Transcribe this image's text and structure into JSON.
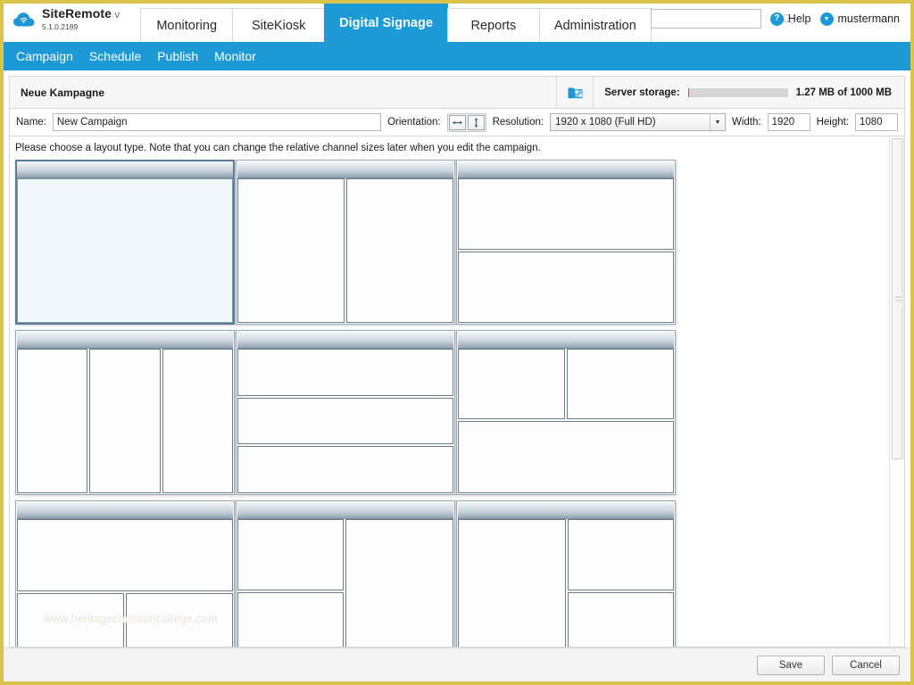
{
  "brand": {
    "name": "SiteRemote",
    "version": "V 5.1.0.2189",
    "logo_icon": "cloud-icon"
  },
  "nav": {
    "tabs": [
      {
        "label": "Monitoring",
        "active": false
      },
      {
        "label": "SiteKiosk",
        "active": false
      },
      {
        "label": "Digital Signage",
        "active": true
      },
      {
        "label": "Reports",
        "active": false
      },
      {
        "label": "Administration",
        "active": false
      }
    ]
  },
  "search": {
    "value": "",
    "placeholder": "",
    "icon": "search-icon"
  },
  "help": {
    "label": "Help",
    "icon": "question-mark-icon"
  },
  "user": {
    "label": "mustermann",
    "icon": "chevron-down-icon"
  },
  "subnav": {
    "items": [
      {
        "label": "Campaign"
      },
      {
        "label": "Schedule"
      },
      {
        "label": "Publish"
      },
      {
        "label": "Monitor"
      }
    ]
  },
  "panel": {
    "title": "Neue Kampagne",
    "storage_icon": "server-storage-icon",
    "storage_label": "Server storage:",
    "storage_value": "1.27 MB of 1000 MB",
    "storage_used_mb": 1.27,
    "storage_total_mb": 1000,
    "storage_percent": 0.127
  },
  "form": {
    "name_label": "Name:",
    "name_value": "New Campaign",
    "name_placeholder": "",
    "orientation_label": "Orientation:",
    "orientation_landscape_icon": "arrows-horizontal-icon",
    "orientation_portrait_icon": "arrows-vertical-icon",
    "resolution_label": "Resolution:",
    "resolution_value": "1920 x 1080 (Full HD)",
    "resolution_arrow_icon": "chevron-down-icon",
    "width_label": "Width:",
    "width_value": "1920",
    "height_label": "Height:",
    "height_value": "1080"
  },
  "chooser": {
    "hint": "Please choose a layout type. Note that you can change the relative channel sizes later when you edit the campaign.",
    "watermark": "www.heritagechristiancollege.com",
    "layouts": [
      {
        "name": "layout-single",
        "selected": true
      },
      {
        "name": "layout-two-columns",
        "selected": false
      },
      {
        "name": "layout-two-rows",
        "selected": false
      },
      {
        "name": "layout-three-columns",
        "selected": false
      },
      {
        "name": "layout-three-rows",
        "selected": false
      },
      {
        "name": "layout-two-top-one-bottom",
        "selected": false
      },
      {
        "name": "layout-one-top-two-bottom",
        "selected": false
      },
      {
        "name": "layout-two-left-one-right",
        "selected": false
      },
      {
        "name": "layout-one-left-two-right",
        "selected": false
      }
    ]
  },
  "footer": {
    "save_label": "Save",
    "cancel_label": "Cancel"
  },
  "colors": {
    "accent": "#1b9ad6",
    "window_border": "#d9c44b",
    "tile_border": "#9aa8b5",
    "selected_tile_fill": "#f2f8fb"
  }
}
